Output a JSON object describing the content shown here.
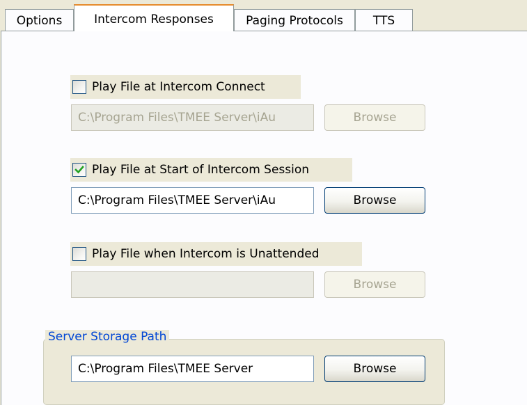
{
  "tabs": [
    {
      "label": "Options",
      "active": false
    },
    {
      "label": "Intercom Responses",
      "active": true
    },
    {
      "label": "Paging Protocols",
      "active": false
    },
    {
      "label": "TTS",
      "active": false
    }
  ],
  "sections": [
    {
      "checkbox_label": "Play File at Intercom Connect",
      "checked": false,
      "path_value": "C:\\Program Files\\TMEE Server\\iAu",
      "enabled": false,
      "browse_label": "Browse"
    },
    {
      "checkbox_label": "Play File at Start of Intercom Session",
      "checked": true,
      "path_value": "C:\\Program Files\\TMEE Server\\iAu",
      "enabled": true,
      "browse_label": "Browse"
    },
    {
      "checkbox_label": "Play File when Intercom is Unattended",
      "checked": false,
      "path_value": "",
      "enabled": false,
      "browse_label": "Browse"
    }
  ],
  "server_storage": {
    "title": "Server Storage Path",
    "path_value": "C:\\Program Files\\TMEE Server",
    "browse_label": "Browse"
  },
  "colors": {
    "window_bg": "#ece9d8",
    "tab_accent": "#e68b2c",
    "group_title": "#0046d5",
    "checkmark": "#21a121"
  }
}
